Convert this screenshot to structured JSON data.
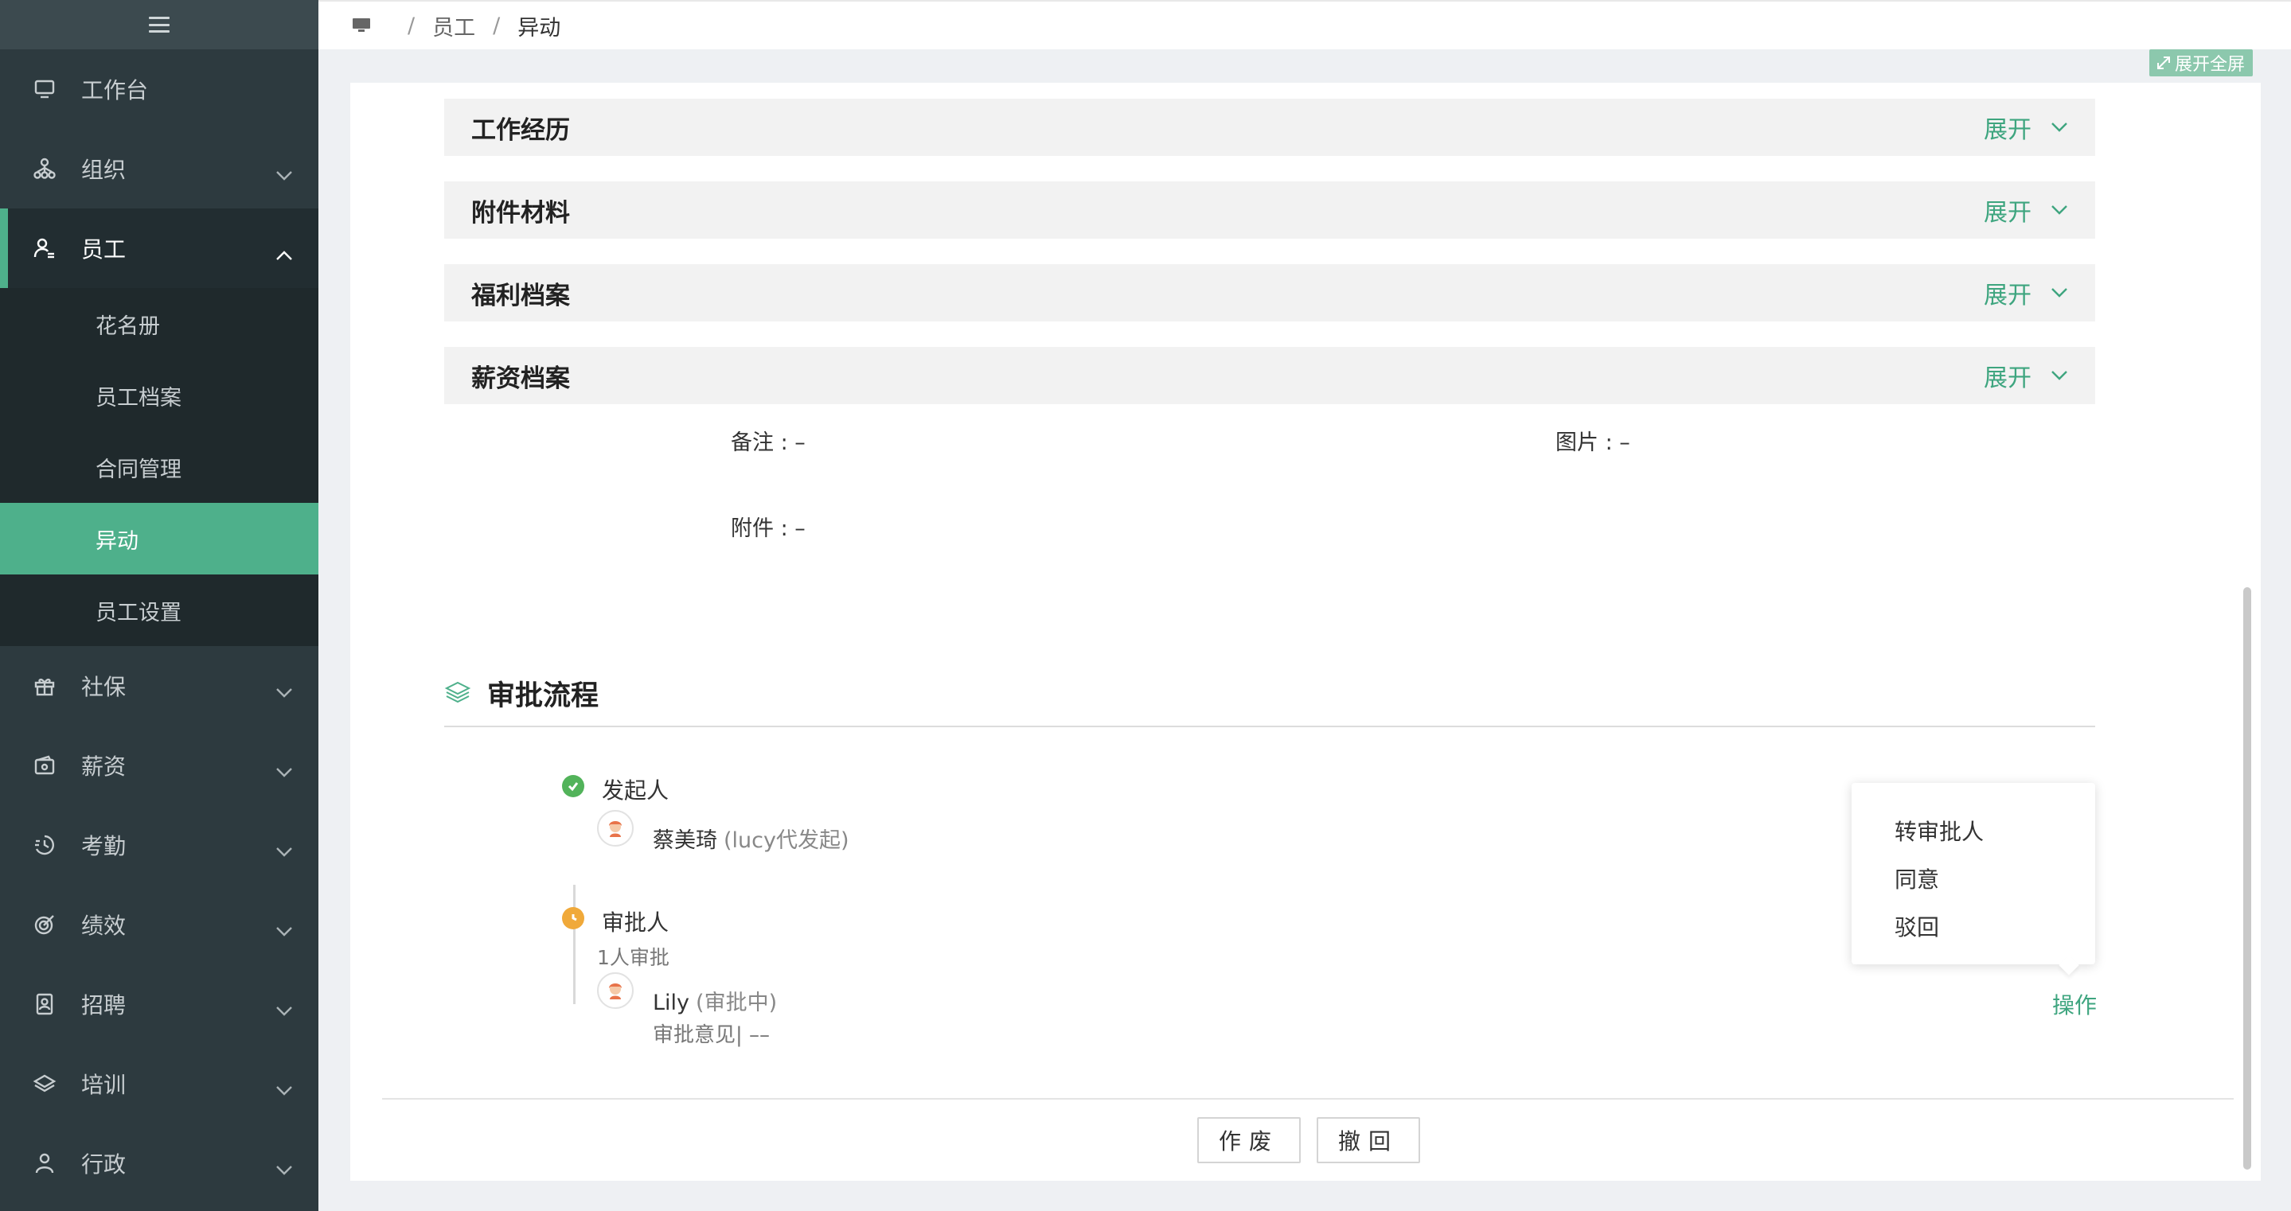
{
  "sidebar": {
    "items": [
      {
        "label": "工作台",
        "icon": "monitor-icon"
      },
      {
        "label": "组织",
        "icon": "org-chart-icon"
      },
      {
        "label": "员工",
        "icon": "employee-icon"
      },
      {
        "label": "社保",
        "icon": "gift-icon"
      },
      {
        "label": "薪资",
        "icon": "wallet-icon"
      },
      {
        "label": "考勤",
        "icon": "clock-icon"
      },
      {
        "label": "绩效",
        "icon": "target-icon"
      },
      {
        "label": "招聘",
        "icon": "badge-icon"
      },
      {
        "label": "培训",
        "icon": "layers-icon"
      },
      {
        "label": "行政",
        "icon": "person-icon"
      }
    ],
    "employee_submenu": [
      "花名册",
      "员工档案",
      "合同管理",
      "异动",
      "员工设置"
    ]
  },
  "breadcrumb": {
    "home_icon": "computer-icon",
    "level1": "员工",
    "level2": "异动",
    "separator": "/"
  },
  "fullscreen_label": "展开全屏",
  "sections": [
    {
      "title": "工作经历",
      "action": "展开"
    },
    {
      "title": "附件材料",
      "action": "展开"
    },
    {
      "title": "福利档案",
      "action": "展开"
    },
    {
      "title": "薪资档案",
      "action": "展开"
    }
  ],
  "fields": {
    "remark": "备注 : –",
    "picture": "图片 : –",
    "attachment": "附件 : –"
  },
  "approval": {
    "title": "审批流程",
    "initiator_label": "发起人",
    "initiator_name": "蔡美琦",
    "initiator_note": "(lucy代发起)",
    "approver_label": "审批人",
    "approver_count": "1人审批",
    "approver_name": "Lily",
    "approver_status": "(审批中)",
    "approver_comment": "审批意见| ––",
    "operation_link": "操作"
  },
  "dropdown": [
    "转审批人",
    "同意",
    "驳回"
  ],
  "buttons": {
    "void": "作废",
    "withdraw": "撤回"
  },
  "colors": {
    "accent": "#4eb08b",
    "sidebar_bg": "#2d3a3f",
    "status_done": "#52b35a",
    "status_pending": "#f0a93a"
  }
}
